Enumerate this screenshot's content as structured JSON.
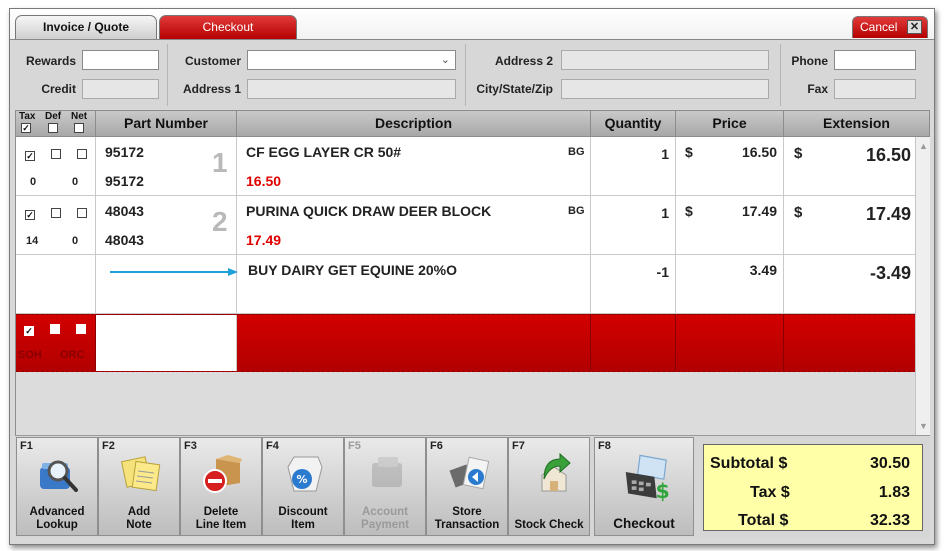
{
  "tabs": {
    "invoice": "Invoice / Quote",
    "checkout": "Checkout"
  },
  "cancel": {
    "label": "Cancel",
    "close_glyph": "✕"
  },
  "header": {
    "rewards_label": "Rewards",
    "credit_label": "Credit",
    "customer_label": "Customer",
    "address1_label": "Address 1",
    "address2_label": "Address 2",
    "citystatezip_label": "City/State/Zip",
    "phone_label": "Phone",
    "fax_label": "Fax",
    "rewards_value": "",
    "credit_value": "",
    "customer_value": "",
    "address1_value": "",
    "address2_value": "",
    "citystatezip_value": "",
    "phone_value": "",
    "fax_value": ""
  },
  "grid": {
    "columns": {
      "tax": "Tax",
      "def": "Def",
      "net": "Net",
      "part": "Part Number",
      "description": "Description",
      "quantity": "Quantity",
      "price": "Price",
      "extension": "Extension"
    },
    "rows": [
      {
        "line": "1",
        "tax_checked": true,
        "def_checked": false,
        "net_checked": false,
        "sub_a": "0",
        "sub_b": "0",
        "part": "95172",
        "part2": "95172",
        "description": "CF EGG LAYER CR 50#",
        "unit": "BG",
        "price_red": "16.50",
        "quantity": "1",
        "price_currency": "$",
        "price": "16.50",
        "ext_currency": "$",
        "extension": "16.50"
      },
      {
        "line": "2",
        "tax_checked": true,
        "def_checked": false,
        "net_checked": false,
        "sub_a": "14",
        "sub_b": "0",
        "part": "48043",
        "part2": "48043",
        "description": "PURINA QUICK DRAW DEER BLOCK",
        "unit": "BG",
        "price_red": "17.49",
        "quantity": "1",
        "price_currency": "$",
        "price": "17.49",
        "ext_currency": "$",
        "extension": "17.49"
      }
    ],
    "discount": {
      "description": "BUY DAIRY GET EQUINE 20%O",
      "quantity": "-1",
      "price": "3.49",
      "extension": "-3.49"
    },
    "active_row": {
      "left_text": "SOH",
      "right_text": "ORC"
    }
  },
  "toolbar": {
    "buttons": [
      {
        "key": "F1",
        "label": "Advanced\nLookup",
        "icon": "magnifier-icon"
      },
      {
        "key": "F2",
        "label": "Add\nNote",
        "icon": "notes-icon"
      },
      {
        "key": "F3",
        "label": "Delete\nLine Item",
        "icon": "box-delete-icon"
      },
      {
        "key": "F4",
        "label": "Discount\nItem",
        "icon": "discount-tag-icon"
      },
      {
        "key": "F5",
        "label": "Account\nPayment",
        "icon": "wallet-icon"
      },
      {
        "key": "F6",
        "label": "Store\nTransaction",
        "icon": "store-transaction-icon"
      },
      {
        "key": "F7",
        "label": "Stock Check",
        "icon": "stock-check-icon"
      },
      {
        "key": "F8",
        "label": "Checkout",
        "icon": "register-icon"
      }
    ]
  },
  "totals": {
    "subtotal_label": "Subtotal $",
    "subtotal": "30.50",
    "tax_label": "Tax $",
    "tax": "1.83",
    "total_label": "Total $",
    "total": "32.33"
  },
  "colors": {
    "accent_red": "#c40000",
    "totals_bg": "#ffffa8",
    "discount_arrow": "#1ea0d8",
    "price_red": "#e00000"
  }
}
